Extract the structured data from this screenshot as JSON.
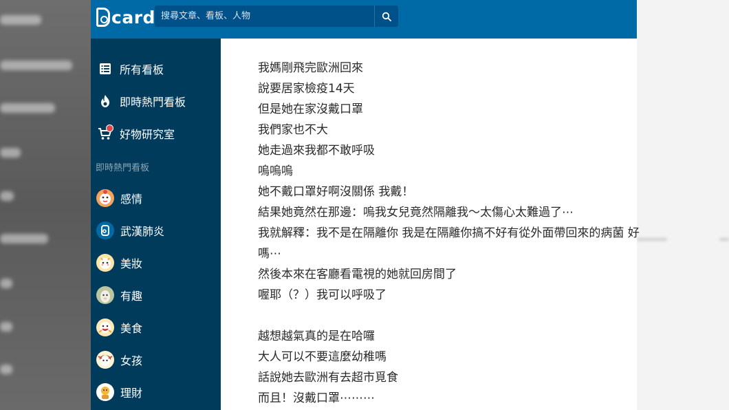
{
  "header": {
    "logo_text": "card",
    "search_placeholder": "搜尋文章、看板、人物",
    "search_icon": "search-icon"
  },
  "sidebar": {
    "nav": [
      {
        "label": "所有看板",
        "icon": "list-icon"
      },
      {
        "label": "即時熱門看板",
        "icon": "flame-icon"
      },
      {
        "label": "好物研究室",
        "icon": "cart-icon"
      }
    ],
    "section_title": "即時熱門看板",
    "boards": [
      {
        "label": "感情",
        "icon": "love-avatar"
      },
      {
        "label": "武漢肺炎",
        "icon": "dcard-avatar"
      },
      {
        "label": "美妝",
        "icon": "makeup-avatar"
      },
      {
        "label": "有趣",
        "icon": "alpaca-avatar"
      },
      {
        "label": "美食",
        "icon": "food-avatar"
      },
      {
        "label": "女孩",
        "icon": "girl-avatar"
      },
      {
        "label": "理財",
        "icon": "finance-avatar"
      }
    ]
  },
  "post": {
    "lines": [
      "我媽剛飛完歐洲回來",
      "說要居家檢疫14天",
      "但是她在家沒戴口罩",
      "我們家也不大",
      "她走過來我都不敢呼吸",
      "嗚嗚嗚",
      "她不戴口罩好啊沒關係 我戴！",
      "結果她竟然在那邊：嗚我女兒竟然隔離我～太傷心太難過了⋯",
      "我就解釋：我不是在隔離你 我是在隔離你搞不好有從外面帶回來的病菌 好",
      "嗎⋯",
      "然後本來在客廳看電視的她就回房間了",
      "喔耶（？）我可以呼吸了",
      "",
      "越想越氣真的是在哈囉",
      "大人可以不要這麼幼稚嗎",
      "話說她去歐洲有去超市覓食",
      "而且！沒戴口罩⋯⋯⋯"
    ]
  }
}
